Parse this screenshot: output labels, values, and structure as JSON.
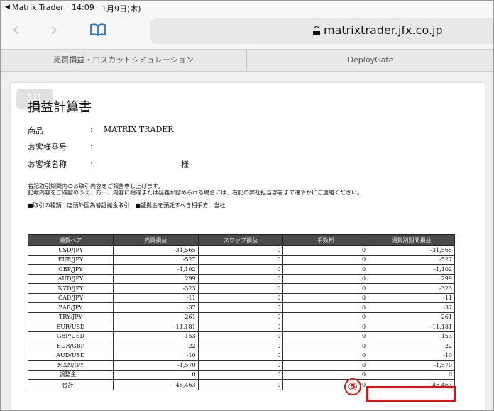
{
  "status_bar": {
    "back_arrow": "◀",
    "back_app": "Matrix Trader",
    "time": "14:09",
    "date": "1月9日(木)"
  },
  "toolbar": {
    "back_glyph": "‹",
    "forward_glyph": "›",
    "url": "matrixtrader.jfx.co.jp"
  },
  "tabs": [
    {
      "label": "売買損益・ロスカットシミュレーション"
    },
    {
      "label": "DeployGate"
    }
  ],
  "document": {
    "page_badge": "1/1",
    "title": "損益計算書",
    "info": [
      {
        "label": "商品",
        "colon": ":",
        "value": "MATRIX TRADER"
      },
      {
        "label": "お客様番号",
        "colon": ":",
        "value": ""
      },
      {
        "label": "お客様名称",
        "colon": ":",
        "value": ""
      }
    ],
    "honorific": "様",
    "notices": [
      "右記取引期間内のお取引内容をご報告申し上げます。",
      "記載内容をご確認のうえ、万一、内容に相違または疑義が認められる場合には、右記の弊社担当部署まで速やかにご連絡ください。",
      "■取引の種類：店頭外国為替証拠金取引　■証拠金を預託すべき相手方：当社"
    ]
  },
  "table": {
    "headers": [
      "通貨ペア",
      "売買損益",
      "スワップ損益",
      "手数料",
      "通貨別期間損益"
    ],
    "rows": [
      [
        "USD/JPY",
        "-31,565",
        "0",
        "0",
        "-31,565"
      ],
      [
        "EUR/JPY",
        "-527",
        "0",
        "0",
        "-527"
      ],
      [
        "GBP/JPY",
        "-1,102",
        "0",
        "0",
        "-1,102"
      ],
      [
        "AUD/JPY",
        "299",
        "0",
        "0",
        "299"
      ],
      [
        "NZD/JPY",
        "-323",
        "0",
        "0",
        "-323"
      ],
      [
        "CAD/JPY",
        "-11",
        "0",
        "0",
        "-11"
      ],
      [
        "ZAR/JPY",
        "-37",
        "0",
        "0",
        "-37"
      ],
      [
        "TRY/JPY",
        "-261",
        "0",
        "0",
        "-261"
      ],
      [
        "EUR/USD",
        "-11,181",
        "0",
        "0",
        "-11,181"
      ],
      [
        "GBP/USD",
        "-153",
        "0",
        "0",
        "-153"
      ],
      [
        "EUR/GBP",
        "-22",
        "0",
        "0",
        "-22"
      ],
      [
        "AUD/USD",
        "-10",
        "0",
        "0",
        "-10"
      ],
      [
        "MXN/JPY",
        "-1,570",
        "0",
        "0",
        "-1,570"
      ],
      [
        "調整金：",
        "0",
        "0",
        "0",
        "0"
      ]
    ],
    "total": [
      "合計：",
      "-46,463",
      "0",
      "0",
      "-46,463"
    ]
  },
  "annotation": {
    "step_number": "⑤",
    "color": "#dd1111"
  }
}
